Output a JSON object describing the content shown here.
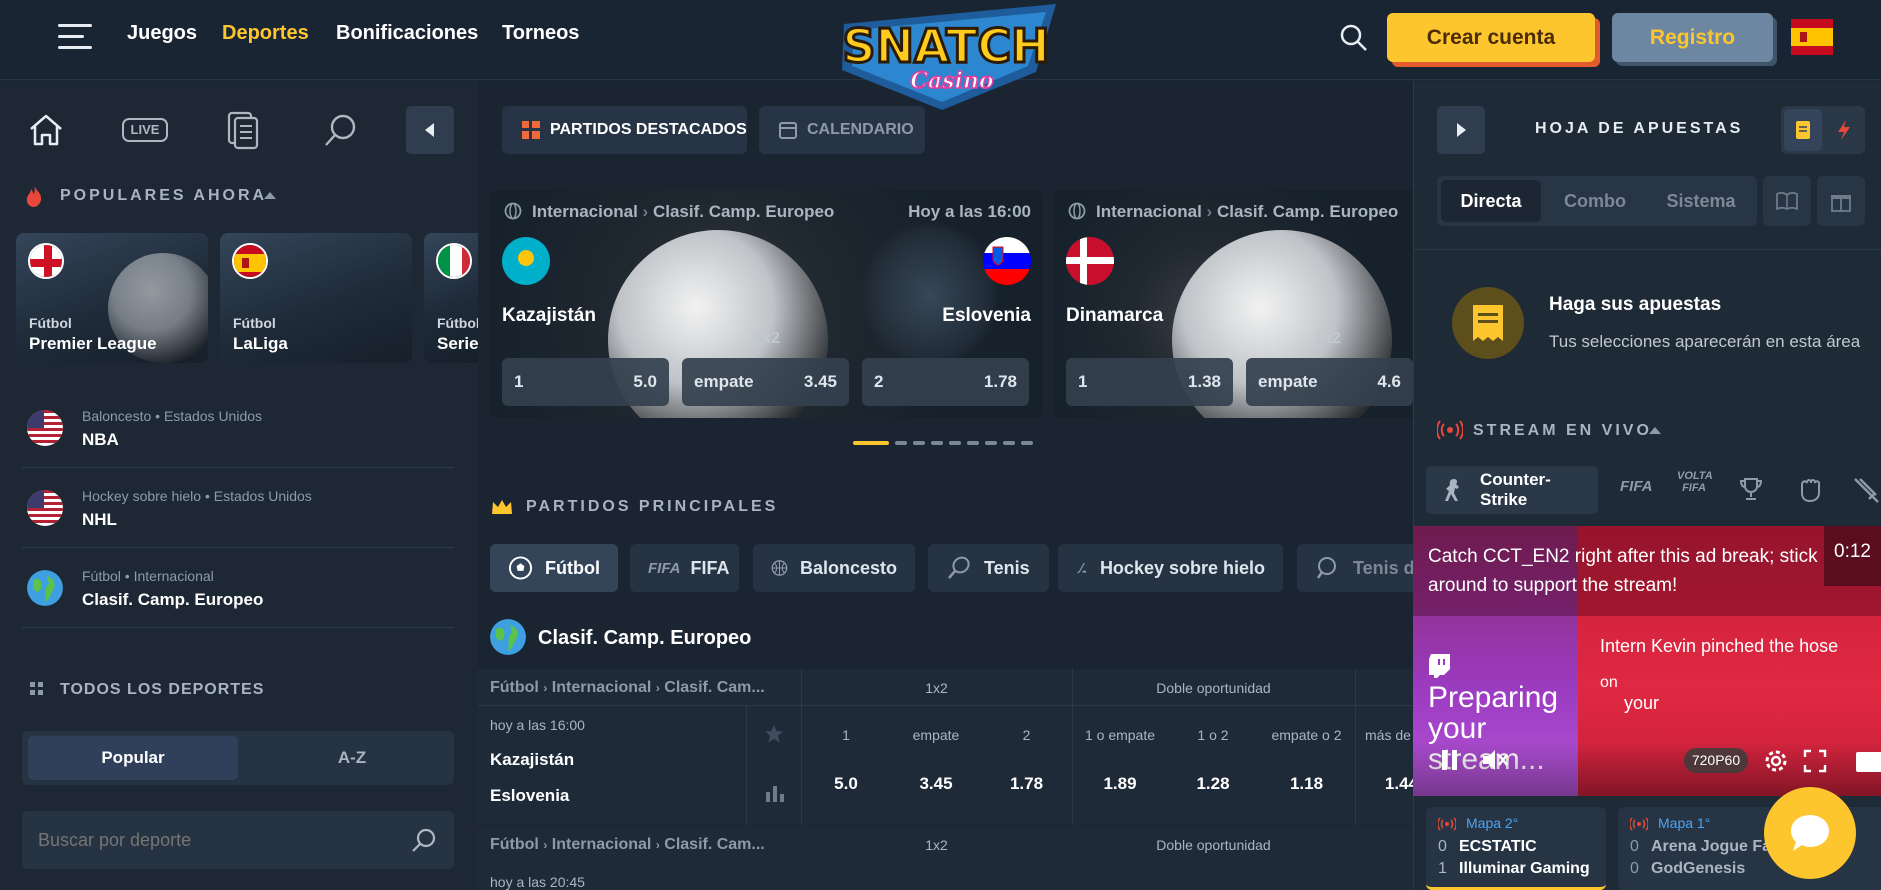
{
  "header": {
    "nav": [
      "Juegos",
      "Deportes",
      "Bonificaciones",
      "Torneos"
    ],
    "active_nav": "Deportes",
    "logo_text": "SNATCH",
    "logo_sub": "Casino",
    "create_account": "Crear cuenta",
    "register": "Registro"
  },
  "sidebar": {
    "live_label": "LIVE",
    "popular_title": "POPULARES AHORA",
    "popular_cards": [
      {
        "sport": "Fútbol",
        "name": "Premier League",
        "flag": "england"
      },
      {
        "sport": "Fútbol",
        "name": "LaLiga",
        "flag": "spain"
      },
      {
        "sport": "Fútbol",
        "name": "Serie",
        "flag": "italy"
      }
    ],
    "leagues": [
      {
        "sport": "Baloncesto",
        "country": "Estados Unidos",
        "name": "NBA",
        "flag": "usa"
      },
      {
        "sport": "Hockey sobre hielo",
        "country": "Estados Unidos",
        "name": "NHL",
        "flag": "usa"
      },
      {
        "sport": "Fútbol",
        "country": "Internacional",
        "name": "Clasif. Camp. Europeo",
        "flag": "globe"
      }
    ],
    "all_sports_title": "TODOS LOS DEPORTES",
    "sort_popular": "Popular",
    "sort_az": "A-Z",
    "search_placeholder": "Buscar por deporte"
  },
  "center": {
    "tab_featured": "PARTIDOS DESTACADOS",
    "tab_calendar": "CALENDARIO",
    "featured": [
      {
        "region": "Internacional",
        "league": "Clasif. Camp. Europeo",
        "time": "Hoy a las 16:00",
        "home": "Kazajistán",
        "away": "Eslovenia",
        "market": "1x2",
        "odds": [
          {
            "label": "1",
            "value": "5.0"
          },
          {
            "label": "empate",
            "value": "3.45"
          },
          {
            "label": "2",
            "value": "1.78"
          }
        ]
      },
      {
        "region": "Internacional",
        "league": "Clasif. Camp. Europeo",
        "time": "",
        "home": "Dinamarca",
        "away": "",
        "market": "1x2",
        "odds": [
          {
            "label": "1",
            "value": "1.38"
          },
          {
            "label": "empate",
            "value": "4.6"
          }
        ]
      }
    ],
    "main_title": "PARTIDOS PRINCIPALES",
    "sports": [
      "Fútbol",
      "FIFA",
      "Baloncesto",
      "Tenis",
      "Hockey sobre hielo",
      "Tenis de mesa"
    ],
    "league_title": "Clasif. Camp. Europeo",
    "breadcrumb": "Fútbol › Internacional › Clasif. Cam...",
    "breadcrumb_parts": [
      "Fútbol",
      "Internacional",
      "Clasif. Cam..."
    ],
    "market_1x2": "1x2",
    "market_double": "Doble oportunidad",
    "columns": [
      "1",
      "empate",
      "2",
      "1 o empate",
      "1 o 2",
      "empate o 2",
      "más de"
    ],
    "row1": {
      "time": "hoy a las 16:00",
      "home": "Kazajistán",
      "away": "Eslovenia",
      "values": [
        "5.0",
        "3.45",
        "1.78",
        "1.89",
        "1.28",
        "1.18",
        "1.44"
      ]
    },
    "row2": {
      "time": "hoy a las 20:45"
    }
  },
  "betslip": {
    "title": "HOJA DE APUESTAS",
    "tabs": [
      "Directa",
      "Combo",
      "Sistema"
    ],
    "empty_title": "Haga sus apuestas",
    "empty_text": "Tus selecciones aparecerán en esta área"
  },
  "stream": {
    "title": "STREAM EN VIVO",
    "game_active": "Counter-Strike",
    "game_icons": [
      "FIFA",
      "VOLTA FIFA",
      "trophy",
      "fist-FIFA",
      "sword"
    ],
    "ad_text": "Catch CCT_EN2 right after this ad break; stick around to support the stream!",
    "ad_timer": "0:12",
    "preparing": "Preparing your stream...",
    "overlay_text_1": "Intern Kevin pinched the hose",
    "overlay_text_2": "on",
    "overlay_text_3": "your",
    "quality": "720P60",
    "cards": [
      {
        "map": "Mapa 2°",
        "teams": [
          {
            "score": "0",
            "name": "ECSTATIC"
          },
          {
            "score": "1",
            "name": "Illuminar Gaming"
          }
        ]
      },
      {
        "map": "Mapa 1°",
        "teams": [
          {
            "score": "0",
            "name": "Arena Jogue Fac"
          },
          {
            "score": "0",
            "name": "GodGenesis"
          }
        ]
      }
    ]
  },
  "colors": {
    "accent": "#fdc52e",
    "bg": "#1b2633",
    "panel": "#263446"
  }
}
